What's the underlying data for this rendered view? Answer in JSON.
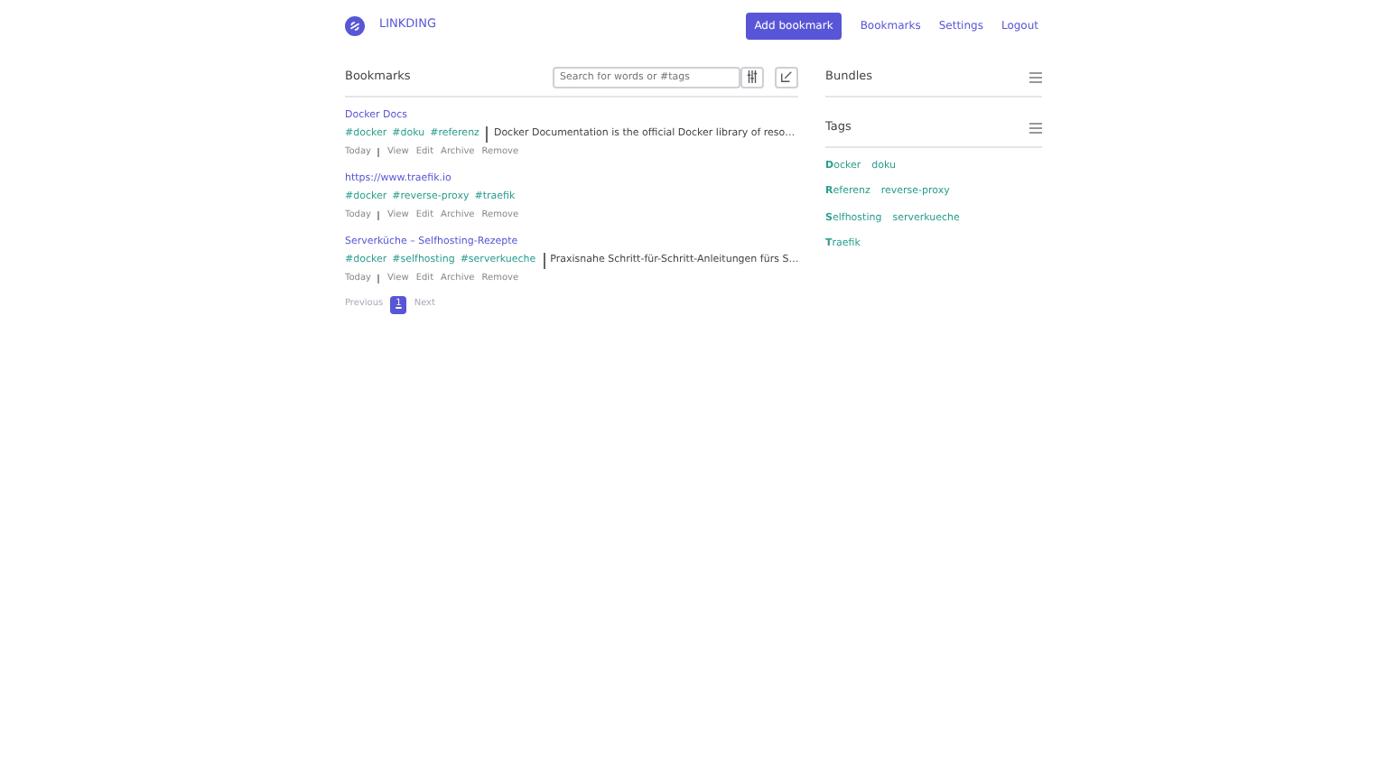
{
  "navbar": {
    "brand": "LINKDING",
    "add_button": "Add bookmark",
    "links": [
      "Bookmarks",
      "Settings",
      "Logout"
    ]
  },
  "bookmarks_panel": {
    "title": "Bookmarks",
    "search": {
      "placeholder": "Search for words or #tags"
    },
    "items": [
      {
        "title": "Docker Docs",
        "tags": [
          "#docker",
          "#doku",
          "#referenz"
        ],
        "description": "Docker Documentation is the official Docker library of reso…",
        "date": "Today",
        "actions": [
          "View",
          "Edit",
          "Archive",
          "Remove"
        ]
      },
      {
        "title": "https://www.traefik.io",
        "tags": [
          "#docker",
          "#reverse-proxy",
          "#traefik"
        ],
        "date": "Today",
        "actions": [
          "View",
          "Edit",
          "Archive",
          "Remove"
        ]
      },
      {
        "title": "Serverküche – Selfhosting-Rezepte",
        "tags": [
          "#docker",
          "#selfhosting",
          "#serverkueche"
        ],
        "description": "Praxisnahe Schritt-für-Schritt-Anleitungen fürs S…",
        "date": "Today",
        "actions": [
          "View",
          "Edit",
          "Archive",
          "Remove"
        ]
      }
    ],
    "pagination": {
      "previous": {
        "label": "Previous",
        "disabled": true
      },
      "pages": [
        {
          "label": "1",
          "selected": true
        }
      ],
      "next": {
        "label": "Next",
        "disabled": true
      }
    }
  },
  "bundles_panel": {
    "title": "Bundles"
  },
  "tags_panel": {
    "title": "Tags",
    "groups": [
      [
        "**D**ocker",
        "doku"
      ],
      [
        "**R**eferenz",
        "reverse-proxy"
      ],
      [
        "**S**elfhosting",
        "serverkueche"
      ],
      [
        "**T**raefik"
      ]
    ]
  }
}
